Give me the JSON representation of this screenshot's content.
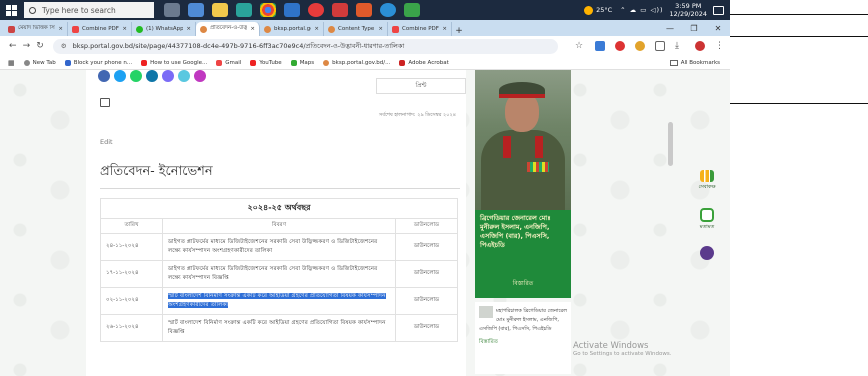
{
  "taskbar": {
    "search_placeholder": "Type here to search",
    "weather": "25°C",
    "time": "3:59 PM",
    "date": "12/29/2024"
  },
  "tabs": [
    {
      "label": "মেয়াদ ভিত্তিক সিট রিপোর্ট",
      "color": "#c44"
    },
    {
      "label": "Combine PDF -",
      "color": "#e44"
    },
    {
      "label": "(1) WhatsApp",
      "color": "#2b2"
    },
    {
      "label": "প্রতিবেদন-ও-উদ্ভাবন",
      "color": "#d84",
      "active": true
    },
    {
      "label": "bksp.portal.gov",
      "color": "#d84"
    },
    {
      "label": "Content Type",
      "color": "#d84"
    },
    {
      "label": "Combine PDF -",
      "color": "#e44"
    }
  ],
  "address": {
    "url": "bksp.portal.gov.bd/site/page/44377108-dc4e-497b-9716-6ff3ac70e9c4/প্রতিবেদন-ও-উদ্ভাবনী-ধারণার-তালিকা"
  },
  "bookmarks": {
    "items": [
      {
        "label": "New Tab",
        "color": "#888"
      },
      {
        "label": "Block your phone n...",
        "color": "#36c"
      },
      {
        "label": "How to use Google...",
        "color": "#e22"
      },
      {
        "label": "Gmail",
        "color": "#e44"
      },
      {
        "label": "YouTube",
        "color": "#e22"
      },
      {
        "label": "Maps",
        "color": "#3a3"
      },
      {
        "label": "bksp.portal.gov.bd/...",
        "color": "#d84"
      },
      {
        "label": "Adobe Acrobat",
        "color": "#c22"
      }
    ],
    "all_label": "All Bookmarks"
  },
  "page": {
    "share_label": "প্রিন্ট",
    "updated": "সর্বশেষ হালনাগাদ: ২৯ ডিসেম্বর ২০২৪",
    "edit_label": "Edit",
    "title": "প্রতিবেদন- ইনোভেশন"
  },
  "table": {
    "fiscal_year": "২০২৪-২৫ অর্থবছর",
    "headers": {
      "date": "তারিখ",
      "subject": "বিবরণ",
      "download": "ডাউনলোড"
    },
    "rows": [
      {
        "date": "২৪-১১-২০২৪",
        "subject": "ডাইগত প্লাটফর্মের মাধ্যমে ডিজিটাইজেশনের সরকারি সেবা উদ্ভিজ্জকরণ ও ডিজিটাইজেশনের লক্ষ্যে কার্যসম্পাদন অংশগ্রহণকারীদের তালিকা",
        "download": "ডাউনলোড"
      },
      {
        "date": "১৭-১১-২০২৪",
        "subject": "ডাইগত প্লাটফর্মের মাধ্যমে ডিজিটাইজেশনের সরকারি সেবা উদ্ভিজ্জকরণ ও ডিজিটাইজেশনের লক্ষ্যে কার্যসম্পাদন বিজ্ঞপ্তি",
        "download": "ডাউনলোড"
      },
      {
        "date": "০২-১১-২০২৪",
        "subject": "স্মার্ট বাংলাদেশ বিনির্মাণ সংক্রান্ত একটি করে আইডিয়া গ্রহণের প্রতিযোগিতা বিষয়ক কার্যসম্পাদন অংশগ্রহণকারীদের তালিকা",
        "download": "ডাউনলোড",
        "selected": true
      },
      {
        "date": "২৬-১১-২০২৪",
        "subject": "স্মার্ট বাংলাদেশ বিনির্মাণ সংক্রান্ত একটি করে আইডিয়া গ্রহণের প্রতিযোগিতা বিষয়ক কার্যসম্পাদন বিজ্ঞপ্তি",
        "download": "ডাউনলোড"
      }
    ]
  },
  "sidebar": {
    "officer_name": "ব্রিগেডিয়ার জেনারেল মোঃ মুনীরুল ইসলাম, এনজিপি, এসজিপি (বার), পিএসসি, পিএইচডি",
    "officer_link": "বিস্তারিত",
    "item_text": "মহাপরিচালক ব্রিগেডিয়ার জেনারেল মোঃ মুনীরুল ইসলাম, এনজিপি, এসজিপি (বার), পিএসসি, পিএইচডি",
    "item_more": "বিস্তারিত"
  },
  "activate": {
    "title": "Activate Windows",
    "subtitle": "Go to Settings to activate Windows."
  },
  "rail": {
    "stats_label": "সেবাকক্ষ",
    "help_label": "মতামত"
  }
}
